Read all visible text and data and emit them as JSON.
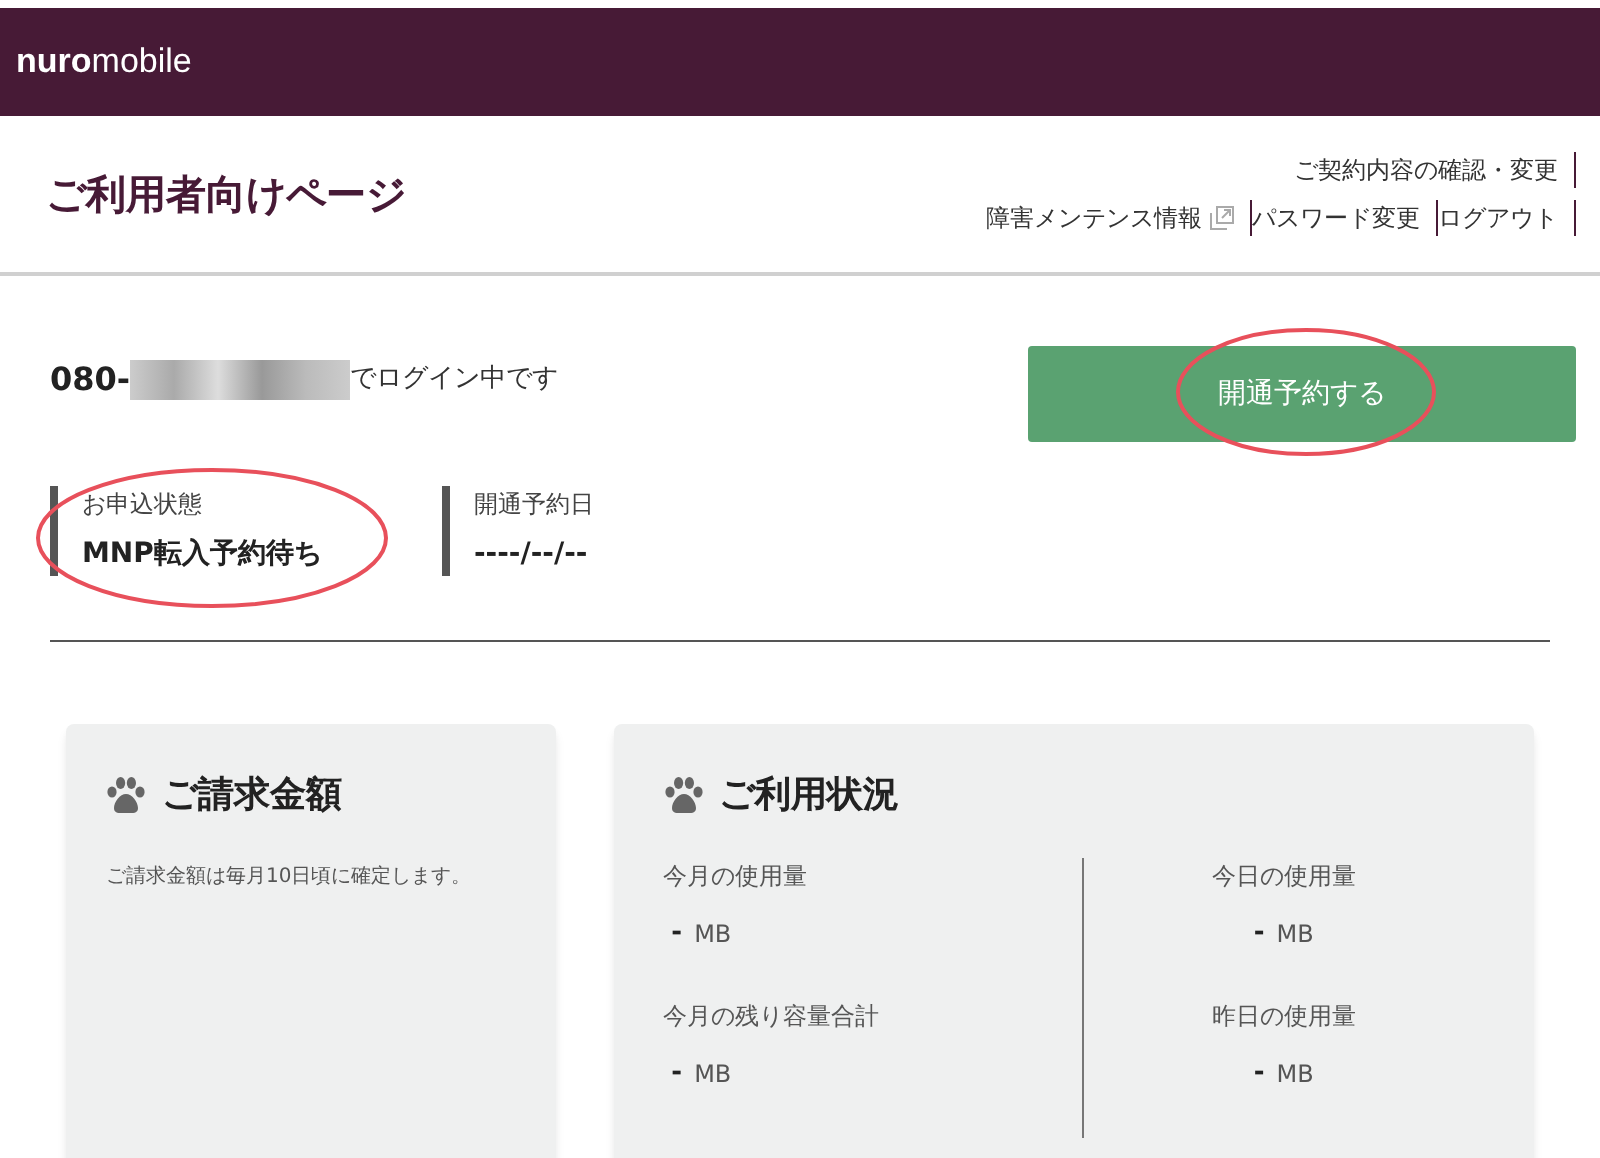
{
  "header": {
    "logo_bold": "nuro",
    "logo_light": "mobile"
  },
  "title_bar": {
    "title": "ご利用者向けページ",
    "link_rows": [
      [
        {
          "label": "ご契約内容の確認・変更",
          "external": false
        }
      ],
      [
        {
          "label": "障害メンテンス情報",
          "external": true
        },
        {
          "label": "パスワード変更",
          "external": false
        },
        {
          "label": "ログアウト",
          "external": false
        }
      ]
    ]
  },
  "login": {
    "number_prefix": "080-",
    "suffix": "でログイン中です"
  },
  "activate_button": "開通予約する",
  "status": [
    {
      "label": "お申込状態",
      "value": "MNP転入予約待ち"
    },
    {
      "label": "開通予約日",
      "value": "----/--/--"
    }
  ],
  "billing_card": {
    "title": "ご請求金額",
    "note": "ご請求金額は毎月10日頃に確定します。"
  },
  "usage_card": {
    "title": "ご利用状況",
    "left": [
      {
        "label": "今月の使用量",
        "value": "-",
        "unit": "MB"
      },
      {
        "label": "今月の残り容量合計",
        "value": "-",
        "unit": "MB"
      }
    ],
    "right": [
      {
        "label": "今日の使用量",
        "value": "-",
        "unit": "MB"
      },
      {
        "label": "昨日の使用量",
        "value": "-",
        "unit": "MB"
      }
    ]
  }
}
